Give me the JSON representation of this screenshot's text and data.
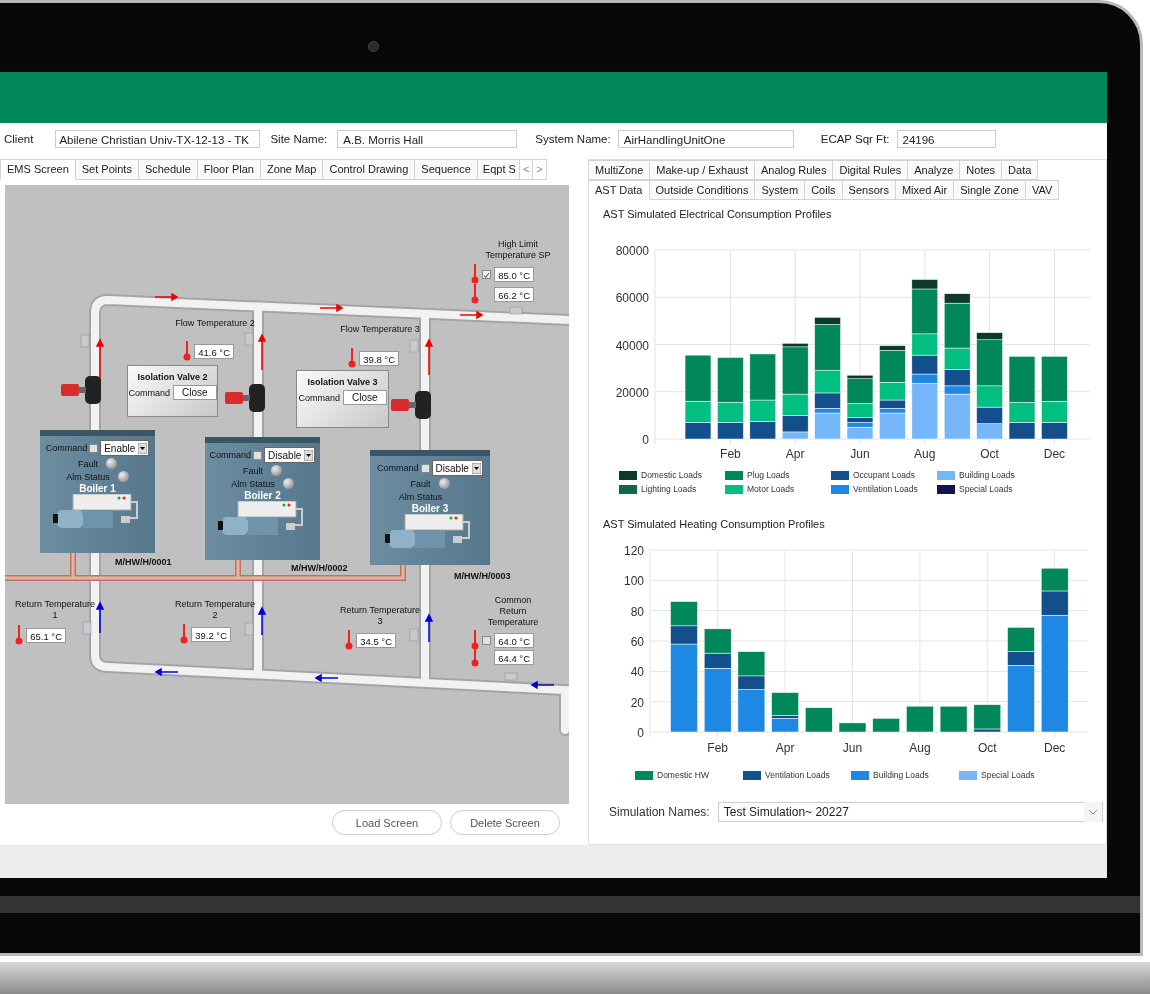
{
  "client_bar": {
    "fields": [
      {
        "label": "Client",
        "value": "Abilene Christian Univ-TX-12-13 - TK"
      },
      {
        "label": "Site Name:",
        "value": "A.B. Morris Hall"
      },
      {
        "label": "System Name:",
        "value": "AirHandlingUnitOne"
      },
      {
        "label": "ECAP Sqr Ft:",
        "value": "24196"
      }
    ]
  },
  "left_panel": {
    "tabs": [
      {
        "label": "EMS Screen",
        "selected": true
      },
      {
        "label": "Set Points",
        "selected": false
      },
      {
        "label": "Schedule",
        "selected": false
      },
      {
        "label": "Floor Plan",
        "selected": false
      },
      {
        "label": "Zone Map",
        "selected": false
      },
      {
        "label": "Control Drawing",
        "selected": false
      },
      {
        "label": "Sequence",
        "selected": false
      },
      {
        "label": "Eqpt S",
        "selected": false
      }
    ],
    "scroll_left": "<",
    "scroll_right": ">",
    "diagram": {
      "high_limit": {
        "label": "High Limit Temperature SP",
        "checked": true,
        "values": [
          "85.0 °C",
          "66.2 °C"
        ]
      },
      "flow_sensors": [
        {
          "label": "Flow Temperature 2",
          "value": "41.6 °C"
        },
        {
          "label": "Flow Temperature 3",
          "value": "39.8 °C"
        }
      ],
      "isolation_valves": [
        {
          "title": "Isolation Valve 2",
          "command_label": "Command",
          "button": "Close"
        },
        {
          "title": "Isolation Valve 3",
          "command_label": "Command",
          "button": "Close"
        }
      ],
      "boilers": [
        {
          "name": "Boiler 1",
          "command_label": "Command",
          "checked": false,
          "command": "Enable",
          "fault_label": "Fault",
          "alarm_label": "Alm Status",
          "alarm_indicator": true,
          "tag": "M/HW/H/0001"
        },
        {
          "name": "Boiler 2",
          "command_label": "Command",
          "checked": false,
          "command": "Disable",
          "fault_label": "Fault",
          "alarm_label": "Alm Status",
          "alarm_indicator": true,
          "tag": "M/HW/H/0002"
        },
        {
          "name": "Boiler 3",
          "command_label": "Command",
          "checked": false,
          "command": "Disable",
          "fault_label": "Fault",
          "alarm_label": "Alm Status",
          "alarm_indicator": false,
          "tag": "M/HW/H/0003"
        }
      ],
      "return_sensors": [
        {
          "label": "Return Temperature 1",
          "value": "65.1 °C"
        },
        {
          "label": "Return Temperature 2",
          "value": "39.2 °C"
        },
        {
          "label": "Return Temperature 3",
          "value": "34.5 °C"
        }
      ],
      "common_return": {
        "label": "Common Return Temperature",
        "checked": false,
        "values": [
          "64.0 °C",
          "64.4 °C"
        ]
      }
    },
    "buttons": [
      "Load Screen",
      "Delete Screen"
    ]
  },
  "right_panel": {
    "tabs_row_1": [
      {
        "label": "MultiZone",
        "selected": false
      },
      {
        "label": "Make-up / Exhaust",
        "selected": false
      },
      {
        "label": "Analog Rules",
        "selected": false
      },
      {
        "label": "Digital Rules",
        "selected": false
      },
      {
        "label": "Analyze",
        "selected": false
      },
      {
        "label": "Notes",
        "selected": false
      },
      {
        "label": "Data",
        "selected": false
      }
    ],
    "tabs_row_2": [
      {
        "label": "AST Data",
        "selected": true
      },
      {
        "label": "Outside Conditions",
        "selected": false
      },
      {
        "label": "System",
        "selected": false
      },
      {
        "label": "Coils",
        "selected": false
      },
      {
        "label": "Sensors",
        "selected": false
      },
      {
        "label": "Mixed Air",
        "selected": false
      },
      {
        "label": "Single Zone",
        "selected": false
      },
      {
        "label": "VAV",
        "selected": false
      }
    ],
    "charts": [
      {
        "chart_data": {
          "type": "bar",
          "title": "AST Simulated Electrical Consumption Profiles",
          "stacked": true,
          "grid": true,
          "categories": [
            null,
            "Feb",
            null,
            "Apr",
            null,
            "Jun",
            null,
            "Aug",
            null,
            "Oct",
            null,
            "Dec"
          ],
          "ylim": [
            0,
            80000
          ],
          "yticks": [
            0,
            20000,
            40000,
            60000,
            80000
          ],
          "series": [
            {
              "name": "Domestic Loads",
              "color": "#0b3b27",
              "values": [
                0,
                0,
                0,
                1500,
                3000,
                1500,
                2000,
                4000,
                4000,
                3000,
                0,
                0
              ]
            },
            {
              "name": "Lighting Loads",
              "color": "#0e6845",
              "values": [
                0,
                0,
                0,
                0,
                0,
                0,
                0,
                0,
                0,
                0,
                0,
                0
              ]
            },
            {
              "name": "Plug Loads",
              "color": "#00875a",
              "values": [
                19500,
                19000,
                19500,
                20000,
                19500,
                10500,
                13500,
                19000,
                19000,
                19500,
                19500,
                19000
              ]
            },
            {
              "name": "Motor Loads",
              "color": "#00bf80",
              "values": [
                9000,
                8500,
                9000,
                9000,
                9500,
                6000,
                7500,
                9000,
                9000,
                9000,
                8500,
                9000
              ]
            },
            {
              "name": "Occupant Loads",
              "color": "#134f8c",
              "values": [
                7000,
                7000,
                7500,
                7000,
                6500,
                2000,
                3500,
                8000,
                7000,
                7000,
                7000,
                7000
              ]
            },
            {
              "name": "Ventilation Loads",
              "color": "#1e88e5",
              "values": [
                0,
                0,
                0,
                0,
                2000,
                2000,
                2000,
                4000,
                3500,
                0,
                0,
                0
              ]
            },
            {
              "name": "Building Loads",
              "color": "#74b6f7",
              "values": [
                0,
                0,
                0,
                3000,
                11000,
                5000,
                11000,
                23500,
                19000,
                6500,
                0,
                0
              ]
            },
            {
              "name": "Special Loads",
              "color": "#13144a",
              "values": [
                0,
                0,
                0,
                0,
                0,
                0,
                0,
                0,
                0,
                0,
                0,
                0
              ]
            }
          ]
        }
      },
      {
        "chart_data": {
          "type": "bar",
          "title": "AST Simulated Heating Consumption Profiles",
          "stacked": true,
          "grid": true,
          "categories": [
            null,
            "Feb",
            null,
            "Apr",
            null,
            "Jun",
            null,
            "Aug",
            null,
            "Oct",
            null,
            "Dec"
          ],
          "ylim": [
            0,
            120
          ],
          "yticks": [
            0,
            20,
            40,
            60,
            80,
            100,
            120
          ],
          "series": [
            {
              "name": "Domestic HW",
              "color": "#00875a",
              "values": [
                16,
                16,
                16,
                15,
                16,
                6,
                9,
                17,
                17,
                16,
                16,
                15
              ]
            },
            {
              "name": "Ventilation Loads",
              "color": "#134f8c",
              "values": [
                12,
                10,
                9,
                2,
                0,
                0,
                0,
                0,
                0,
                2,
                9,
                16
              ]
            },
            {
              "name": "Building Loads",
              "color": "#1e88e5",
              "values": [
                58,
                42,
                28,
                9,
                0,
                0,
                0,
                0,
                0,
                0,
                44,
                77
              ]
            },
            {
              "name": "Special Loads",
              "color": "#74b6f7",
              "values": [
                0,
                0,
                0,
                0,
                0,
                0,
                0,
                0,
                0,
                0,
                0,
                0
              ]
            }
          ]
        }
      }
    ],
    "simulation": {
      "label": "Simulation Names:",
      "value": "Test Simulation~ 20227"
    }
  }
}
